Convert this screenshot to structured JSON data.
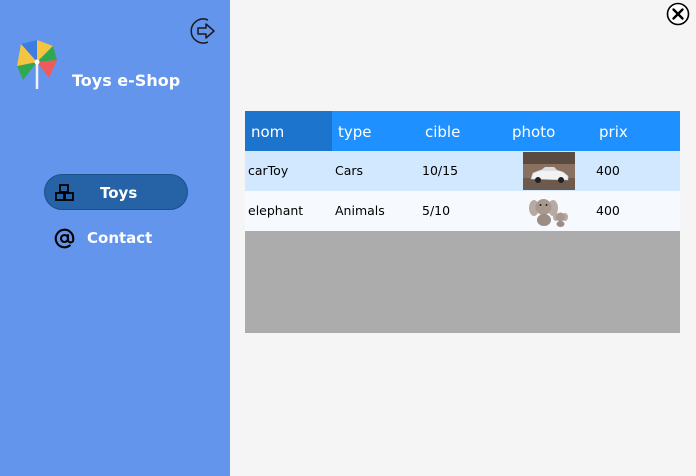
{
  "app": {
    "title": "Toys e-Shop"
  },
  "nav": {
    "toys": "Toys",
    "contact": "Contact"
  },
  "icons": {
    "logout": "logout-arrow-icon",
    "logo": "pinwheel-logo",
    "toys": "blocks-icon",
    "contact": "at-sign-icon",
    "close": "close-circle-icon"
  },
  "colors": {
    "sidebar": "#6495ed",
    "nav_active": "#2563a6",
    "grid_header": "#1e90ff",
    "grid_header_sorted": "#1c74cc",
    "row_selected": "#d2e8ff",
    "grid_empty": "#acacac"
  },
  "table": {
    "columns": [
      "nom",
      "type",
      "cible",
      "photo",
      "prix"
    ],
    "rows": [
      {
        "nom": "carToy",
        "type": "Cars",
        "cible": "10/15",
        "photo": "car-photo",
        "prix": "400"
      },
      {
        "nom": "elephant",
        "type": "Animals",
        "cible": "5/10",
        "photo": "elephant-plush-photo",
        "prix": "400"
      }
    ]
  }
}
